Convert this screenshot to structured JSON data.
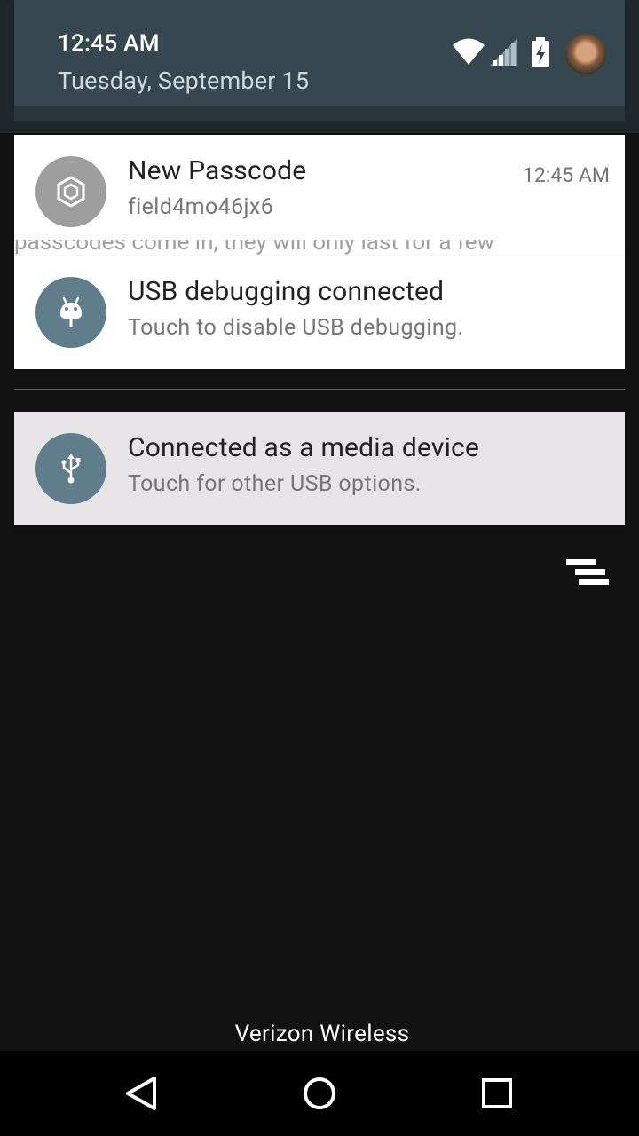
{
  "status_header": {
    "time": "12:45 AM",
    "date": "Tuesday, September 15",
    "icons": [
      "wifi-icon",
      "cell-signal-icon",
      "battery-charging-icon",
      "user-avatar"
    ]
  },
  "notifications": [
    {
      "icon": "passcode-app-icon",
      "icon_bg": "#9e9e9e",
      "title": "New Passcode",
      "text": "field4mo46jx6",
      "time": "12:45 AM"
    },
    {
      "icon": "android-debug-icon",
      "icon_bg": "#607d8b",
      "title": "USB debugging connected",
      "text": "Touch to disable USB debugging."
    },
    {
      "icon": "usb-icon",
      "icon_bg": "#607d8b",
      "title": "Connected as a media device",
      "text": "Touch for other USB options."
    }
  ],
  "background_text": "passcodes come in, they will only last for a few",
  "dismiss_all_icon": "clear-all-icon",
  "carrier": "Verizon Wireless",
  "navbar": {
    "buttons": [
      "back-icon",
      "home-icon",
      "recents-icon"
    ]
  },
  "colors": {
    "header_bg": "#37474f",
    "card_bg": "#ffffff",
    "ongoing_card_bg": "#e6e4e6",
    "screen_bg": "#121212"
  }
}
